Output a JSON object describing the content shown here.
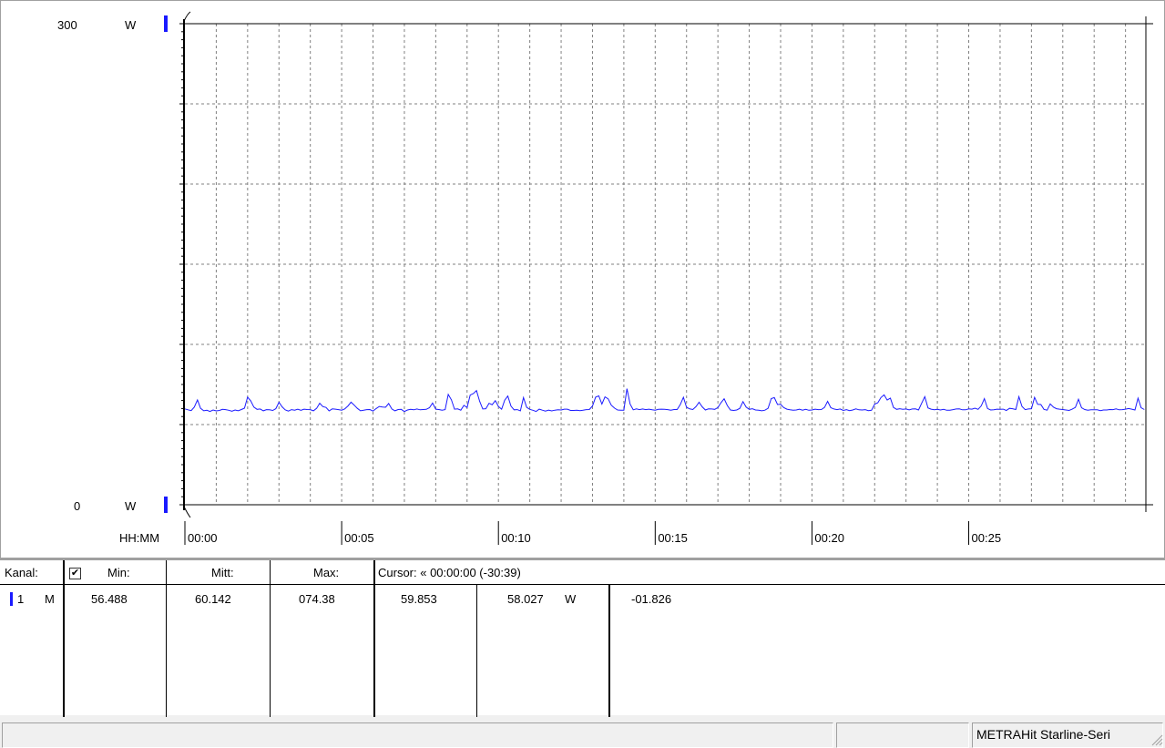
{
  "chart_data": {
    "type": "line",
    "y_axis": {
      "max_label": "300",
      "min_label": "0",
      "unit": "W",
      "ylim": [
        0,
        300
      ]
    },
    "x_axis": {
      "label": "HH:MM",
      "tick_labels": [
        "00:00",
        "00:05",
        "00:10",
        "00:15",
        "00:20",
        "00:25"
      ],
      "xlim_minutes": [
        0,
        30.65
      ]
    },
    "grid": true,
    "colors": {
      "series": "#1a1aff",
      "grid": "#808080"
    },
    "series": [
      {
        "x_minutes": [
          0.0,
          0.1,
          0.2,
          0.3,
          0.4,
          0.5,
          0.6,
          0.7,
          0.8,
          0.9,
          1.0,
          1.1,
          1.2,
          1.3,
          1.4,
          1.5,
          1.6,
          1.7,
          1.8,
          1.9,
          2.0,
          2.1,
          2.2,
          2.3,
          2.4,
          2.5,
          2.6,
          2.7,
          2.8,
          2.9,
          3.0,
          3.1,
          3.2,
          3.3,
          3.4,
          3.5,
          3.6,
          3.7,
          3.8,
          3.9,
          4.0,
          4.1,
          4.2,
          4.3,
          4.4,
          4.5,
          4.6,
          4.7,
          4.8,
          4.9,
          5.0,
          5.1,
          5.2,
          5.3,
          5.4,
          5.5,
          5.6,
          5.7,
          5.8,
          5.9,
          6.0,
          6.1,
          6.2,
          6.3,
          6.4,
          6.5,
          6.6,
          6.7,
          6.8,
          6.9,
          7.0,
          7.1,
          7.2,
          7.3,
          7.4,
          7.5,
          7.6,
          7.7,
          7.8,
          7.9,
          8.0,
          8.1,
          8.2,
          8.3,
          8.4,
          8.5,
          8.6,
          8.7,
          8.8,
          8.9,
          9.0,
          9.1,
          9.2,
          9.3,
          9.4,
          9.5,
          9.6,
          9.7,
          9.8,
          9.9,
          10.0,
          10.1,
          10.2,
          10.3,
          10.4,
          10.5,
          10.6,
          10.7,
          10.8,
          10.9,
          11.0,
          11.1,
          11.2,
          11.3,
          11.4,
          11.5,
          11.6,
          11.7,
          11.8,
          11.9,
          12.0,
          12.1,
          12.2,
          12.3,
          12.4,
          12.5,
          12.6,
          12.7,
          12.8,
          12.9,
          13.0,
          13.1,
          13.2,
          13.3,
          13.4,
          13.5,
          13.6,
          13.7,
          13.8,
          13.9,
          14.0,
          14.1,
          14.2,
          14.3,
          14.4,
          14.5,
          14.6,
          14.7,
          14.8,
          14.9,
          15.0,
          15.1,
          15.2,
          15.3,
          15.4,
          15.5,
          15.6,
          15.7,
          15.8,
          15.9,
          16.0,
          16.1,
          16.2,
          16.3,
          16.4,
          16.5,
          16.6,
          16.7,
          16.8,
          16.9,
          17.0,
          17.1,
          17.2,
          17.3,
          17.4,
          17.5,
          17.6,
          17.7,
          17.8,
          17.9,
          18.0,
          18.1,
          18.2,
          18.3,
          18.4,
          18.5,
          18.6,
          18.7,
          18.8,
          18.9,
          19.0,
          19.1,
          19.2,
          19.3,
          19.4,
          19.5,
          19.6,
          19.7,
          19.8,
          19.9,
          20.0,
          20.1,
          20.2,
          20.3,
          20.4,
          20.5,
          20.6,
          20.7,
          20.8,
          20.9,
          21.0,
          21.1,
          21.2,
          21.3,
          21.4,
          21.5,
          21.6,
          21.7,
          21.8,
          21.9,
          22.0,
          22.1,
          22.2,
          22.3,
          22.4,
          22.5,
          22.6,
          22.7,
          22.8,
          22.9,
          23.0,
          23.1,
          23.2,
          23.3,
          23.4,
          23.5,
          23.6,
          23.7,
          23.8,
          23.9,
          24.0,
          24.1,
          24.2,
          24.3,
          24.4,
          24.5,
          24.6,
          24.7,
          24.8,
          24.9,
          25.0,
          25.1,
          25.2,
          25.3,
          25.4,
          25.5,
          25.6,
          25.7,
          25.8,
          25.9,
          26.0,
          26.1,
          26.2,
          26.3,
          26.4,
          26.5,
          26.6,
          26.7,
          26.8,
          26.9,
          27.0,
          27.1,
          27.2,
          27.3,
          27.4,
          27.5,
          27.6,
          27.7,
          27.8,
          27.9,
          28.0,
          28.1,
          28.2,
          28.3,
          28.4,
          28.5,
          28.6,
          28.7,
          28.8,
          28.9,
          29.0,
          29.1,
          29.2,
          29.3,
          29.4,
          29.5,
          29.6,
          29.7,
          29.8,
          29.9,
          30.0,
          30.1,
          30.2,
          30.3,
          30.4,
          30.5,
          30.6
        ],
        "values_w": [
          59.8,
          59.2,
          58.7,
          60.9,
          65.4,
          60.1,
          58.6,
          58.9,
          58.2,
          59.1,
          58.5,
          58.8,
          59.5,
          59.3,
          58.9,
          58.3,
          59.1,
          58.6,
          59.4,
          60.2,
          67.1,
          64.8,
          60.9,
          59.5,
          59.7,
          58.6,
          59.3,
          59.2,
          58.8,
          59.9,
          63.9,
          61.1,
          59.2,
          58.4,
          59.3,
          59.0,
          59.6,
          58.9,
          59.6,
          59.4,
          59.3,
          58.6,
          60.1,
          63.3,
          61.2,
          60.7,
          58.5,
          59.8,
          59.6,
          59.3,
          59.0,
          59.8,
          61.6,
          64.0,
          62.1,
          60.1,
          58.6,
          58.9,
          59.3,
          59.4,
          58.4,
          60.0,
          61.3,
          60.9,
          60.8,
          63.1,
          59.7,
          58.6,
          59.4,
          59.5,
          58.1,
          59.1,
          59.5,
          59.2,
          59.7,
          59.2,
          59.4,
          59.5,
          60.5,
          63.4,
          59.6,
          59.4,
          59.0,
          59.3,
          68.8,
          65.4,
          59.6,
          59.8,
          59.0,
          62.0,
          60.6,
          68.4,
          69.3,
          71.2,
          64.5,
          59.7,
          59.9,
          63.3,
          62.4,
          64.9,
          61.3,
          59.6,
          65.2,
          67.8,
          61.5,
          59.2,
          59.3,
          58.5,
          66.8,
          60.8,
          59.5,
          58.9,
          58.2,
          59.6,
          59.0,
          58.4,
          59.0,
          58.5,
          59.0,
          59.2,
          59.1,
          59.6,
          59.6,
          58.8,
          58.8,
          58.9,
          58.7,
          59.0,
          59.3,
          59.4,
          61.6,
          67.1,
          67.9,
          62.8,
          67.3,
          66.0,
          62.1,
          60.3,
          59.1,
          59.0,
          59.0,
          72.4,
          62.7,
          59.2,
          59.8,
          59.3,
          59.7,
          59.3,
          59.6,
          59.2,
          59.0,
          59.5,
          59.6,
          59.5,
          59.3,
          59.0,
          59.4,
          59.4,
          62.4,
          67.0,
          60.8,
          59.8,
          59.4,
          61.2,
          63.9,
          61.1,
          59.1,
          59.8,
          59.7,
          59.5,
          60.6,
          63.7,
          66.1,
          61.9,
          59.1,
          58.8,
          59.1,
          60.1,
          64.3,
          60.9,
          59.5,
          59.9,
          59.1,
          58.9,
          58.6,
          59.0,
          60.1,
          66.2,
          66.8,
          62.5,
          62.6,
          60.6,
          59.6,
          59.2,
          58.9,
          59.1,
          59.6,
          59.0,
          59.5,
          58.9,
          59.1,
          59.6,
          59.3,
          59.4,
          60.7,
          64.5,
          60.5,
          59.7,
          59.3,
          59.7,
          58.8,
          59.3,
          58.7,
          59.1,
          59.8,
          59.2,
          59.1,
          59.3,
          58.7,
          58.9,
          62.8,
          63.6,
          66.8,
          68.5,
          65.3,
          66.5,
          60.7,
          59.5,
          59.9,
          59.5,
          59.7,
          59.2,
          59.7,
          59.8,
          59.1,
          63.4,
          67.4,
          60.4,
          59.6,
          59.2,
          59.5,
          59.1,
          59.5,
          58.9,
          59.0,
          59.3,
          59.7,
          59.8,
          59.2,
          59.2,
          59.8,
          59.6,
          60.2,
          59.5,
          61.7,
          66.2,
          60.0,
          59.1,
          59.2,
          59.6,
          59.5,
          59.6,
          58.8,
          60.1,
          59.9,
          59.4,
          67.4,
          61.3,
          59.3,
          59.7,
          59.9,
          67.0,
          62.6,
          62.5,
          59.5,
          59.0,
          62.9,
          60.9,
          59.9,
          59.6,
          59.4,
          59.1,
          58.8,
          59.6,
          60.7,
          65.8,
          60.5,
          59.4,
          59.0,
          59.2,
          59.2,
          59.2,
          58.7,
          59.1,
          59.1,
          59.4,
          59.3,
          59.8,
          59.2,
          59.3,
          59.6,
          60.0,
          59.6,
          59.1,
          66.5,
          60.5,
          59.4,
          59.2,
          59.0,
          59.4,
          59.5,
          59.3,
          59.5,
          59.8,
          58.9,
          58.9,
          59.2,
          59.9,
          60.5,
          63.1,
          62.2,
          59.0,
          59.2,
          59.3,
          59.5,
          58.7,
          59.6,
          59.4,
          58.6,
          59.3,
          59.1,
          60.5,
          59.3,
          59.2,
          58.8,
          58.7
        ]
      }
    ]
  },
  "table": {
    "headers": {
      "kanal": "Kanal:",
      "min": "Min:",
      "mitt": "Mitt:",
      "max": "Max:",
      "cursor": "Cursor: « 00:00:00 (-30:39)"
    },
    "checkbox_mark": "✔",
    "row": {
      "channel": "1",
      "mode": "M",
      "min": "56.488",
      "mitt": "60.142",
      "max": "074.38",
      "cursor_a": "59.853",
      "cursor_b": "58.027",
      "unit": "W",
      "delta": "-01.826"
    }
  },
  "status_bar": {
    "device": "METRAHit Starline-Seri"
  }
}
